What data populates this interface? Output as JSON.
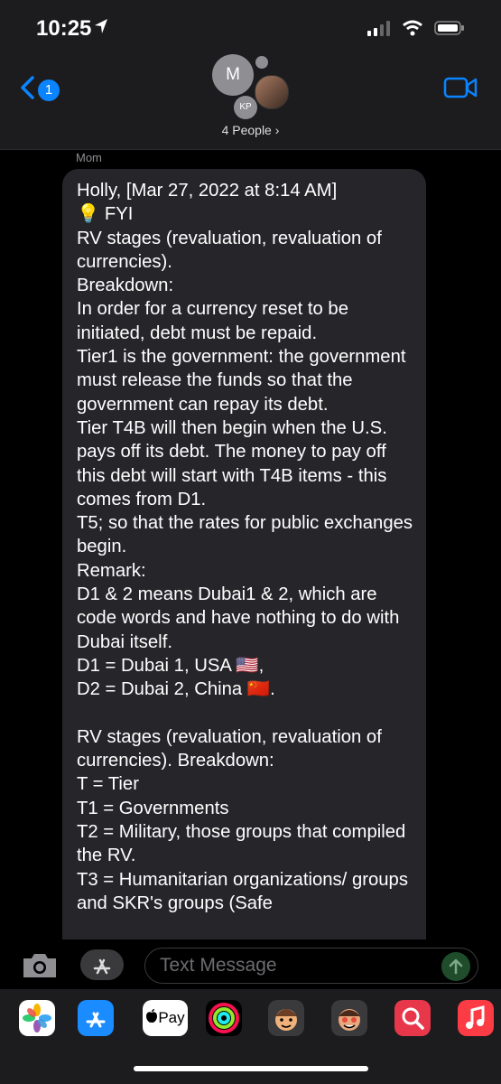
{
  "status_bar": {
    "time": "10:25"
  },
  "header": {
    "back_badge": "1",
    "avatar_initial": "M",
    "avatar_initials_2": "KP",
    "people_label": "4 People ›"
  },
  "message": {
    "sender": "Mom",
    "text": "Holly, [Mar 27, 2022 at 8:14 AM]\n💡 FYI\nRV stages (revaluation, revaluation of currencies).\nBreakdown:\nIn order for a currency reset to be initiated, debt must be repaid.\nTier1 is the government: the government must release the funds so that the government can repay its debt.\nTier T4B will then begin when the U.S. pays off its debt. The money to pay off this debt will start with T4B items - this comes from D1.\nT5; so that the rates for public exchanges begin.\nRemark:\nD1 & 2 means Dubai1 & 2, which are code words and have nothing to do with Dubai itself.\nD1 = Dubai 1, USA 🇺🇸,\nD2 = Dubai 2, China 🇨🇳.\n\nRV stages (revaluation, revaluation of currencies). Breakdown:\nT = Tier\nT1 = Governments\nT2 = Military, those groups that compiled the RV.\nT3 = Humanitarian organizations/ groups and SKR's groups (Safe"
  },
  "compose": {
    "placeholder": "Text Message"
  },
  "app_strip": {
    "apple_pay_label": "Pay"
  },
  "colors": {
    "accent": "#0a84ff",
    "bubble": "#26252a",
    "header": "#1c1c1e",
    "send": "#1f4d2b"
  }
}
